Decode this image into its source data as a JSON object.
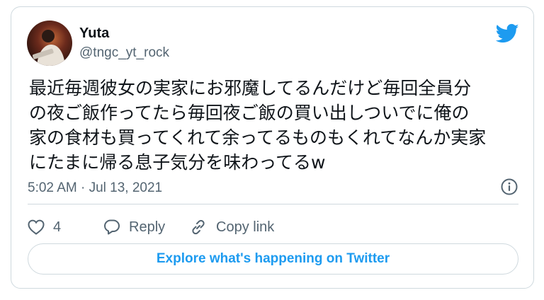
{
  "tweet": {
    "author_name": "Yuta",
    "author_handle": "@tngc_yt_rock",
    "text_lines": [
      "最近毎週彼女の実家にお邪魔してるんだけど毎回全員分",
      "の夜ご飯作ってたら毎回夜ご飯の買い出しついでに俺の",
      "家の食材も買ってくれて余ってるものもくれてなんか実家",
      "にたまに帰る息子気分を味わってるw"
    ],
    "timestamp": "5:02 AM · Jul 13, 2021",
    "like_count": "4",
    "reply_label": "Reply",
    "copy_link_label": "Copy link",
    "explore_label": "Explore what's happening on Twitter"
  },
  "icons": {
    "brand": "twitter-bird-icon",
    "info": "info-icon",
    "like": "heart-icon",
    "reply": "speech-bubble-icon",
    "copy": "link-icon"
  },
  "colors": {
    "brand_blue": "#1d9bf0",
    "text_primary": "#0f1419",
    "text_secondary": "#536471",
    "border": "#cfd9de"
  }
}
